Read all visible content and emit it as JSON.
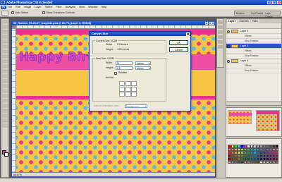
{
  "app": {
    "title": "Adobe Photoshop CS3 Extended",
    "logo_text": "Ps"
  },
  "menu": [
    "File",
    "Edit",
    "Image",
    "Layer",
    "Select",
    "Filter",
    "Analysis",
    "View",
    "Window",
    "Help"
  ],
  "options_bar": {
    "checkboxes": [
      "Auto Select",
      "Show Transform Controls",
      ""
    ],
    "dock_tabs": [
      "Brushes",
      "Tool Presets",
      "Layer Comps"
    ]
  },
  "document": {
    "title": "08_Holmes_09-26-07_template.psd @ 66.7% (Layer 3, RGB/8)",
    "banner_text": "Happy Birth",
    "zoom": "66.67%"
  },
  "dialog": {
    "title": "Canvas Size",
    "current_size_label": "Current Size: 6.02M",
    "current_width_label": "Width:",
    "current_width_value": "5.0 inches",
    "current_height_label": "Height:",
    "current_height_value": "4.25 inches",
    "new_size_label": "New Size: 6.02M",
    "width_label": "Width:",
    "width_value": "11",
    "height_label": "Height:",
    "height_value": "8.5",
    "unit": "inches",
    "relative_label": "Relative",
    "anchor_label": "Anchor:",
    "extension_label": "Canvas extension color:",
    "extension_value": "Background",
    "ok_label": "OK",
    "cancel_label": "Cancel",
    "anchor_arrows": [
      "",
      "",
      "",
      "",
      "",
      "",
      "",
      "",
      ""
    ]
  },
  "layers_panel": {
    "tabs": [
      "Layers",
      "Channels",
      "Paths"
    ],
    "rows": [
      {
        "name": "Layer 5",
        "sub": false,
        "selected": false
      },
      {
        "name": "Effects",
        "sub": true,
        "selected": false
      },
      {
        "name": "Drop Shadow",
        "sub": true,
        "selected": false
      },
      {
        "name": "Layer 3",
        "sub": false,
        "selected": true
      },
      {
        "name": "Effects",
        "sub": true,
        "selected": false
      },
      {
        "name": "Drop Shadow",
        "sub": true,
        "selected": false
      },
      {
        "name": "Layer 6",
        "sub": false,
        "selected": false
      },
      {
        "name": "Effects",
        "sub": true,
        "selected": false
      },
      {
        "name": "Drop Shadow",
        "sub": true,
        "selected": false
      }
    ]
  },
  "thumb_text": "Happy Birthday",
  "colors": {
    "titlebar": "#0a3fb2",
    "canvas_yellow": "#f8c542",
    "dot_pink": "#e8348e",
    "dot_blue": "#5ab9e6",
    "banner_text": "#c44ad8",
    "selected_layer": "#2a55c8"
  },
  "swatch_colors": [
    "#ff0000",
    "#ffff00",
    "#00ff00",
    "#00ffff",
    "#0000ff",
    "#ff00ff",
    "#ffffff",
    "#e6e6e6",
    "#cccccc",
    "#b3b3b3",
    "#999999",
    "#808080",
    "#666666",
    "#4d4d4d",
    "#333333",
    "#000000",
    "#f26c4f",
    "#f68e56",
    "#fbaf5d",
    "#fff568",
    "#acd373",
    "#7cc576",
    "#3bb878",
    "#1abbb4",
    "#00bff3",
    "#438cca",
    "#5574b9",
    "#605ca8",
    "#855fa8",
    "#a763a8",
    "#f06eaa",
    "#f26d7d",
    "#ed1c24",
    "#f26522",
    "#f7941d",
    "#fff200",
    "#8dc63f",
    "#39b54a",
    "#00a651",
    "#00a99d",
    "#00aeef",
    "#0072bc",
    "#0054a6",
    "#2e3192",
    "#662d91",
    "#92278f",
    "#ec008c",
    "#ed145b",
    "#9e0b0f",
    "#a0410d",
    "#a36209",
    "#aba000",
    "#598527",
    "#1a7b30",
    "#007236",
    "#00746b",
    "#0076a3",
    "#004b80",
    "#003471",
    "#1b1464",
    "#440e62",
    "#630460",
    "#9e005d",
    "#9e0039",
    "#790000",
    "#7b2e00",
    "#7d4900",
    "#827b00",
    "#406618",
    "#005e20",
    "#005826",
    "#005952",
    "#005b7f",
    "#003663",
    "#002157",
    "#0d004c",
    "#32004b",
    "#4b0049",
    "#7b0046",
    "#7a0026",
    "#c7b299",
    "#998675",
    "#736357",
    "#534741",
    "#37302d",
    "#c69c6d",
    "#a67c52",
    "#8c6239",
    "#754c24",
    "#603913",
    "#f9e0bb",
    "#e9c9a4",
    "#d9b28d",
    "#c49a6c",
    "#aa8a5e",
    "#8a6e4b"
  ]
}
